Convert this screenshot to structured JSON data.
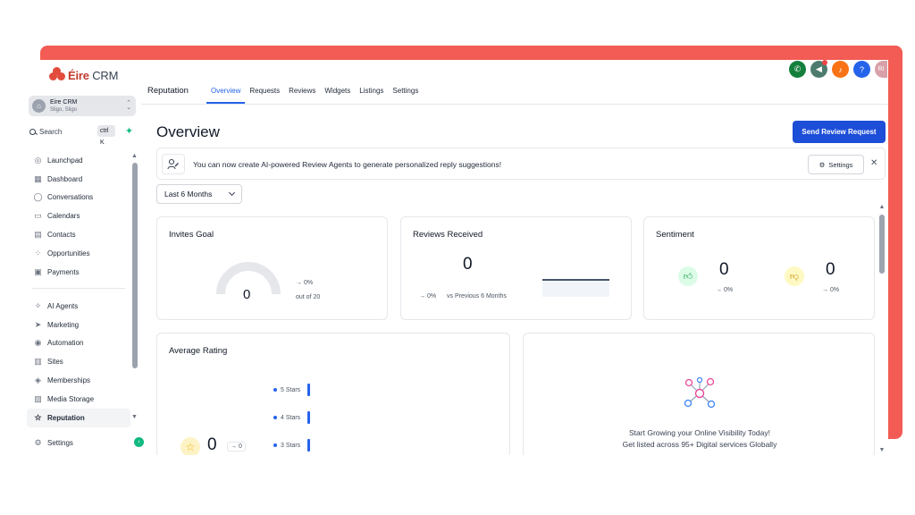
{
  "brand": {
    "logo_text_main": "Éire",
    "logo_text_sub": "CRM",
    "accent_red": "#f25c54",
    "primary_blue": "#1d4ed8"
  },
  "account": {
    "name": "Eire CRM",
    "location": "Sligo, Sligo"
  },
  "search": {
    "label": "Search",
    "shortcut": "ctrl K"
  },
  "sidebar": {
    "items": [
      {
        "label": "Launchpad",
        "icon": "launchpad-icon"
      },
      {
        "label": "Dashboard",
        "icon": "dashboard-icon"
      },
      {
        "label": "Conversations",
        "icon": "chat-icon"
      },
      {
        "label": "Calendars",
        "icon": "calendar-icon"
      },
      {
        "label": "Contacts",
        "icon": "contacts-icon"
      },
      {
        "label": "Opportunities",
        "icon": "opportunities-icon"
      },
      {
        "label": "Payments",
        "icon": "payments-icon"
      }
    ],
    "items2": [
      {
        "label": "AI Agents",
        "icon": "ai-agents-icon"
      },
      {
        "label": "Marketing",
        "icon": "send-icon"
      },
      {
        "label": "Automation",
        "icon": "automation-icon"
      },
      {
        "label": "Sites",
        "icon": "sites-icon"
      },
      {
        "label": "Memberships",
        "icon": "memberships-icon"
      },
      {
        "label": "Media Storage",
        "icon": "media-icon"
      },
      {
        "label": "Reputation",
        "icon": "star-icon"
      }
    ],
    "settings_label": "Settings"
  },
  "header": {
    "section": "Reputation",
    "tabs": [
      "Overview",
      "Requests",
      "Reviews",
      "Widgets",
      "Listings",
      "Settings"
    ],
    "active_tab": "Overview",
    "avatar_initials": "RI"
  },
  "main": {
    "title": "Overview",
    "send_button": "Send Review Request",
    "banner_text": "You can now create AI-powered Review Agents to generate personalized reply suggestions!",
    "banner_settings": "Settings",
    "range": "Last 6 Months",
    "invites": {
      "title": "Invites Goal",
      "value": "0",
      "change": "→ 0%",
      "goal": "out of 20"
    },
    "reviews": {
      "title": "Reviews Received",
      "value": "0",
      "change": "→ 0%",
      "compare": "vs Previous 6 Months"
    },
    "sentiment": {
      "title": "Sentiment",
      "positive": "0",
      "positive_change": "→ 0%",
      "negative": "0",
      "negative_change": "→ 0%"
    },
    "rating": {
      "title": "Average Rating",
      "value": "0",
      "change": "→ 0",
      "rows": [
        "5 Stars",
        "4 Stars",
        "3 Stars"
      ]
    },
    "promo": {
      "line1": "Start Growing your Online Visibility Today!",
      "line2": "Get listed across 95+ Digital services Globally"
    }
  }
}
